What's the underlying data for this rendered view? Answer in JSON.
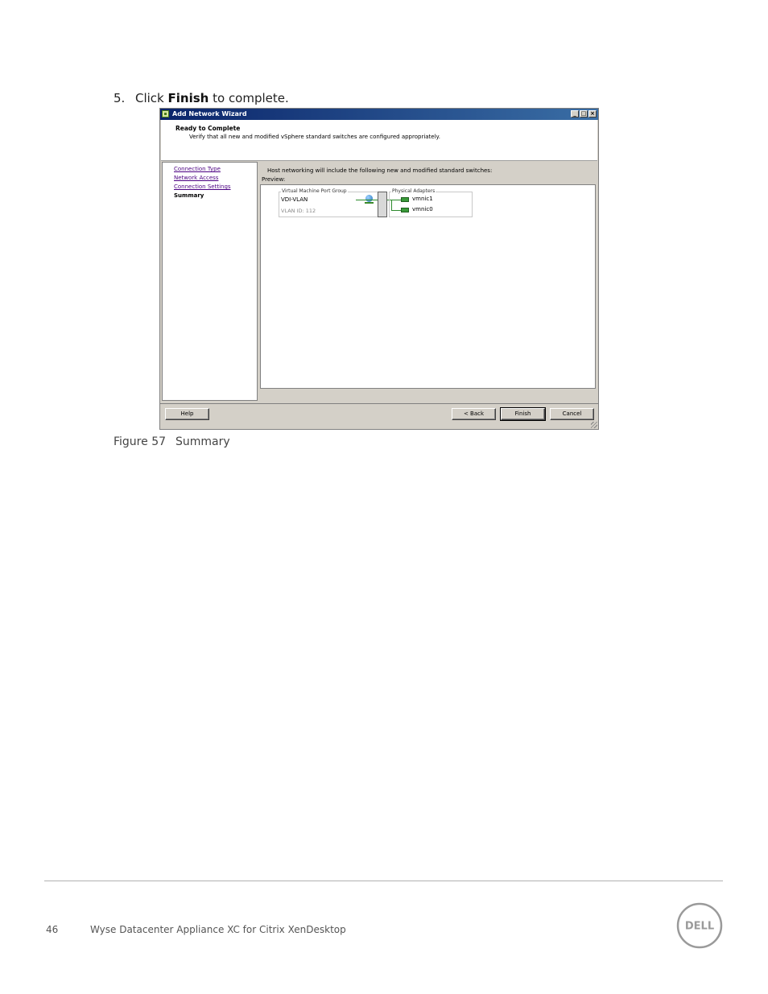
{
  "step": {
    "number": "5.",
    "prefix": "Click ",
    "bold": "Finish",
    "suffix": " to complete."
  },
  "wizard": {
    "title": "Add Network Wizard",
    "window_buttons": [
      "_",
      "□",
      "×"
    ],
    "header": {
      "title": "Ready to Complete",
      "subtitle": "Verify that all new and modified vSphere standard switches are configured appropriately."
    },
    "nav": {
      "items": [
        {
          "label": "Connection Type",
          "state": "link"
        },
        {
          "label": "Network Access",
          "state": "link"
        },
        {
          "label": "Connection Settings",
          "state": "link"
        },
        {
          "label": "Summary",
          "state": "current"
        }
      ]
    },
    "intro": "Host networking will include the following new and modified standard switches:",
    "preview_label": "Preview:",
    "port_group": {
      "group_label": "Virtual Machine Port Group",
      "name": "VDI-VLAN",
      "vlan": "VLAN ID: 112"
    },
    "adapters": {
      "group_label": "Physical Adapters",
      "items": [
        "vmnic1",
        "vmnic0"
      ]
    },
    "buttons": {
      "help": "Help",
      "back": "< Back",
      "finish": "Finish",
      "cancel": "Cancel"
    },
    "icons": {
      "app": "network-wizard-icon",
      "globe": "vm-network-icon",
      "nic": "nic-icon"
    }
  },
  "caption": {
    "number": "Figure 57",
    "text": "Summary"
  },
  "footer": {
    "page_number": "46",
    "doc_title": "Wyse Datacenter Appliance XC for Citrix XenDesktop",
    "logo_text": "DELL"
  },
  "colors": {
    "titlebar": "#0a246a",
    "link": "#4b0082",
    "nic": "#3a9a3a"
  }
}
